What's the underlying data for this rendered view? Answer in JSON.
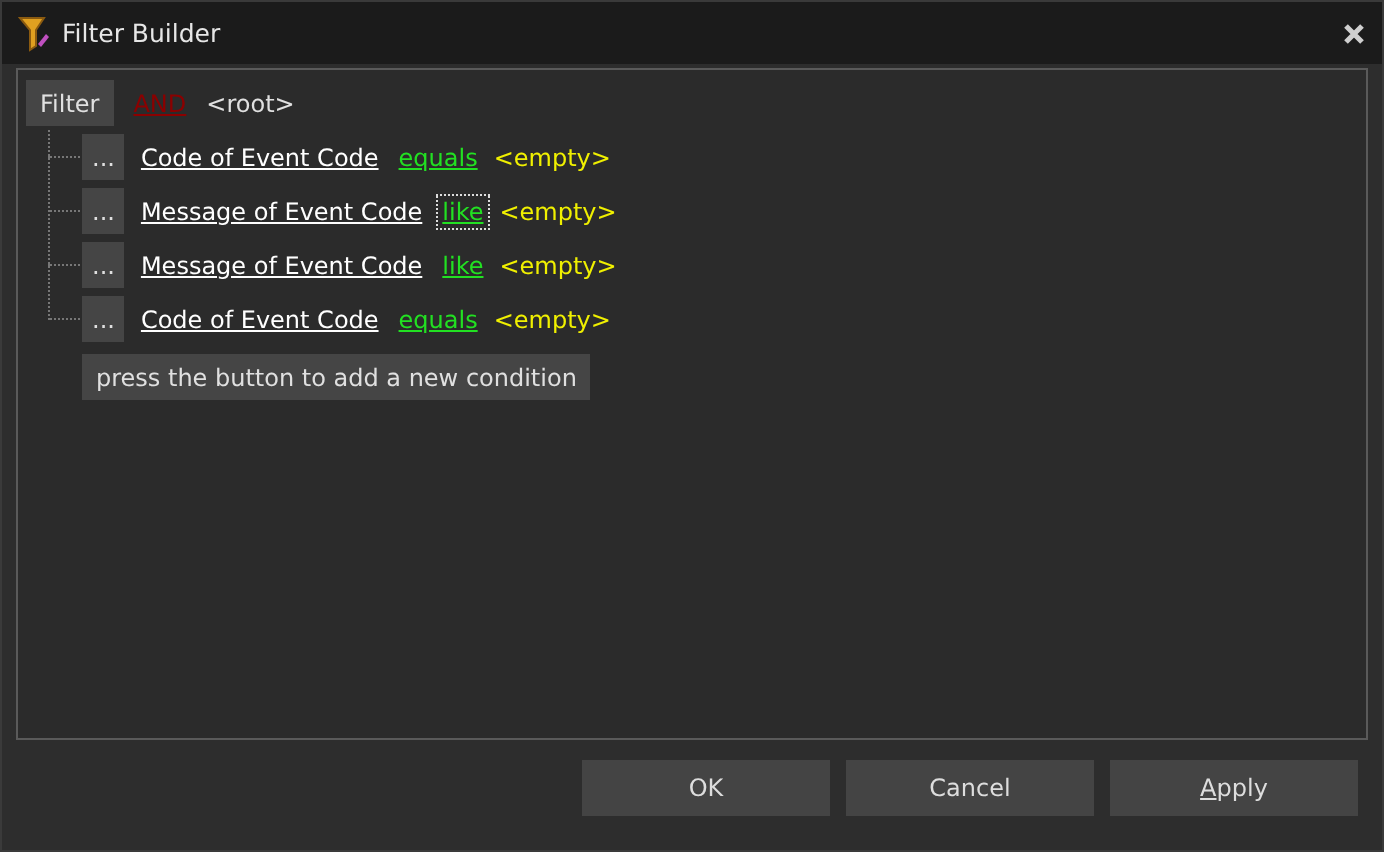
{
  "window": {
    "title": "Filter Builder"
  },
  "filter": {
    "button": "Filter",
    "group_operator": "AND",
    "group_name": "<root>",
    "conditions": [
      {
        "menu": "...",
        "field": "Code of Event Code",
        "operator": "equals",
        "value": "<empty>",
        "focused": false
      },
      {
        "menu": "...",
        "field": "Message of Event Code",
        "operator": "like",
        "value": "<empty>",
        "focused": true
      },
      {
        "menu": "...",
        "field": "Message of Event Code",
        "operator": "like",
        "value": "<empty>",
        "focused": false
      },
      {
        "menu": "...",
        "field": "Code of Event Code",
        "operator": "equals",
        "value": "<empty>",
        "focused": false
      }
    ],
    "add_hint": "press the button to add a new condition"
  },
  "buttons": [
    {
      "label": "OK",
      "kind": "plain"
    },
    {
      "label": "Cancel",
      "kind": "plain"
    },
    {
      "label": "Apply",
      "kind": "mnemonic"
    }
  ]
}
